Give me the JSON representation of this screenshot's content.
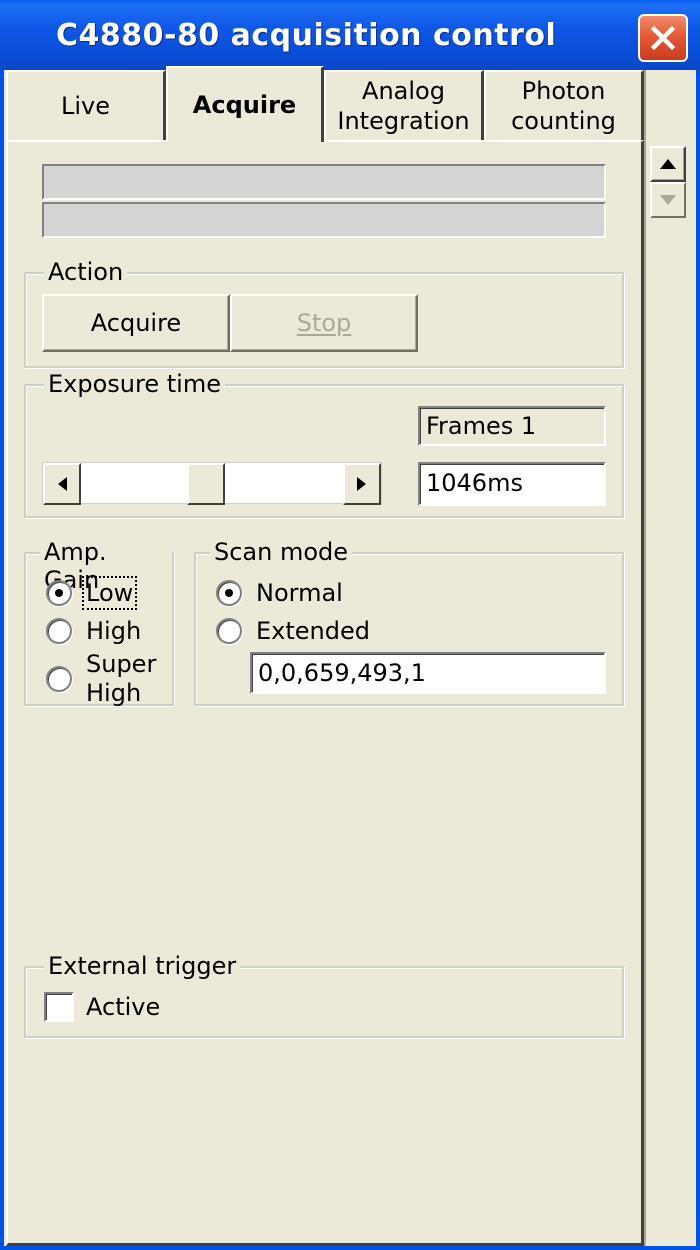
{
  "window": {
    "title": "C4880-80 acquisition control",
    "close_label": "Close"
  },
  "tabs": [
    {
      "label_line1": "Live",
      "label_line2": "",
      "active": false
    },
    {
      "label_line1": "Acquire",
      "label_line2": "",
      "active": true
    },
    {
      "label_line1": "Analog",
      "label_line2": "Integration",
      "active": false
    },
    {
      "label_line1": "Photon",
      "label_line2": "counting",
      "active": false
    }
  ],
  "action": {
    "group_label": "Action",
    "acquire_label": "Acquire",
    "stop_label": "Stop",
    "stop_enabled": false
  },
  "exposure": {
    "group_label": "Exposure time",
    "frames_text": "Frames 1",
    "time_value": "1046ms"
  },
  "amp_gain": {
    "group_label": "Amp. Gain",
    "options": [
      {
        "label": "Low",
        "selected": true
      },
      {
        "label": "High",
        "selected": false
      },
      {
        "label_line1": "Super",
        "label_line2": "High",
        "selected": false
      }
    ]
  },
  "scan_mode": {
    "group_label": "Scan mode",
    "options": [
      {
        "label": "Normal",
        "selected": true
      },
      {
        "label": "Extended",
        "selected": false
      }
    ],
    "region_value": "0,0,659,493,1"
  },
  "external_trigger": {
    "group_label": "External trigger",
    "active_label": "Active",
    "checked": false
  },
  "colors": {
    "title_bar": "#0a4fd8",
    "close_button": "#e35a36",
    "window_face": "#ece9d8"
  }
}
